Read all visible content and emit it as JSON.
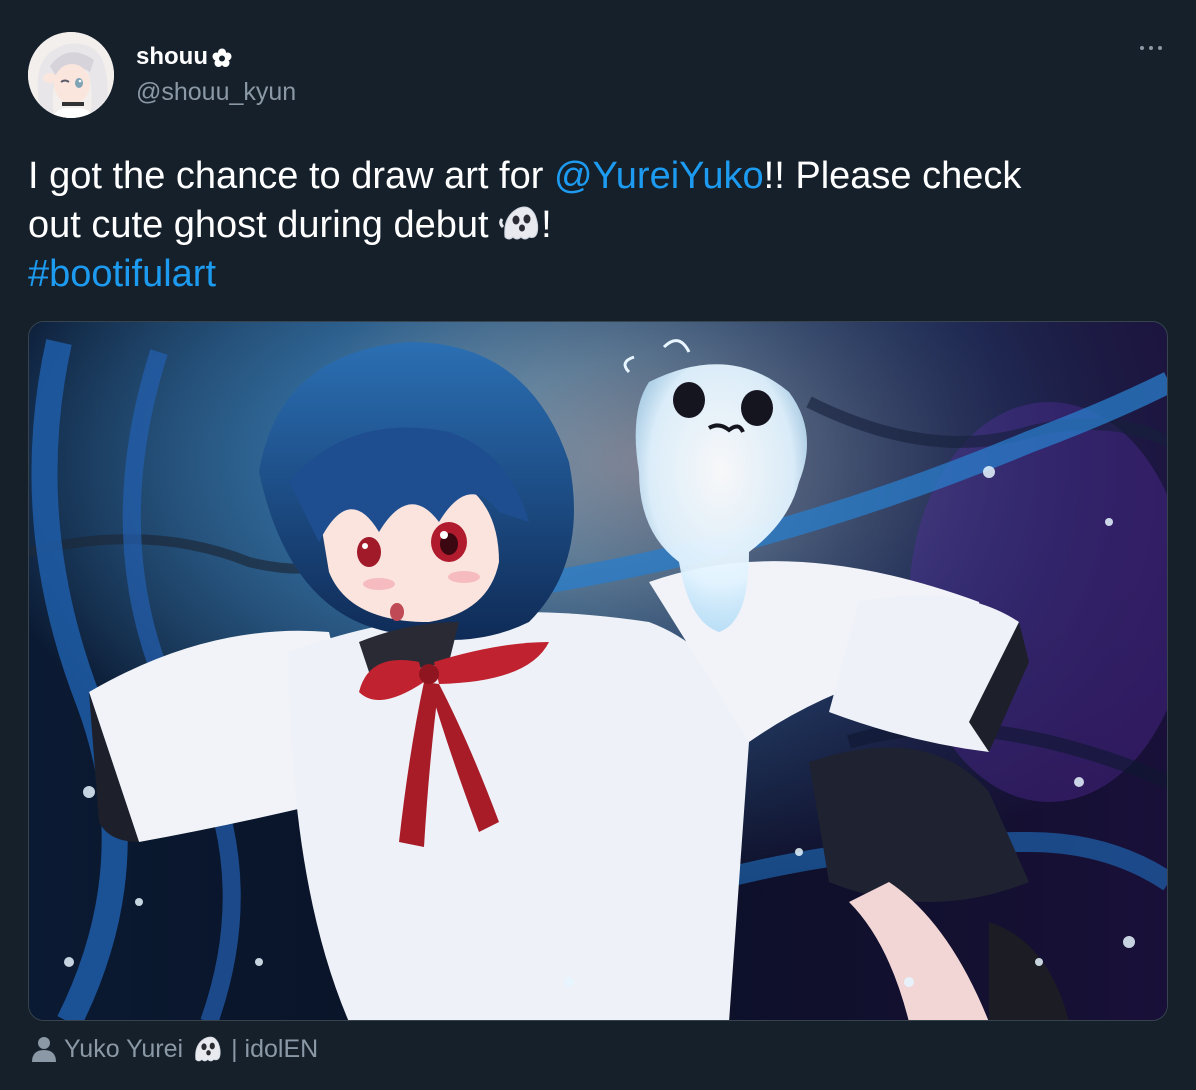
{
  "author": {
    "display_name": "shouu",
    "handle": "@shouu_kyun",
    "badge_icon": "flower-icon"
  },
  "menu": {
    "icon": "more-icon"
  },
  "tweet": {
    "line1_pre": "I got the chance to draw art for ",
    "mention": "@YureiYuko",
    "line1_post": "!! Please check",
    "line2_pre": "out cute ghost during debut ",
    "line2_post": "!",
    "hashtag": "#bootifulart",
    "emoji": "ghost-emoji"
  },
  "media": {
    "type": "illustration",
    "subject": "anime-girl-with-ghost"
  },
  "tagged": {
    "icon": "person-icon",
    "name_pre": "Yuko Yurei",
    "name_post": "| idolEN"
  },
  "colors": {
    "background": "#15202b",
    "link": "#1d9bf0",
    "secondary_text": "#8b98a5",
    "border": "#38444d"
  }
}
